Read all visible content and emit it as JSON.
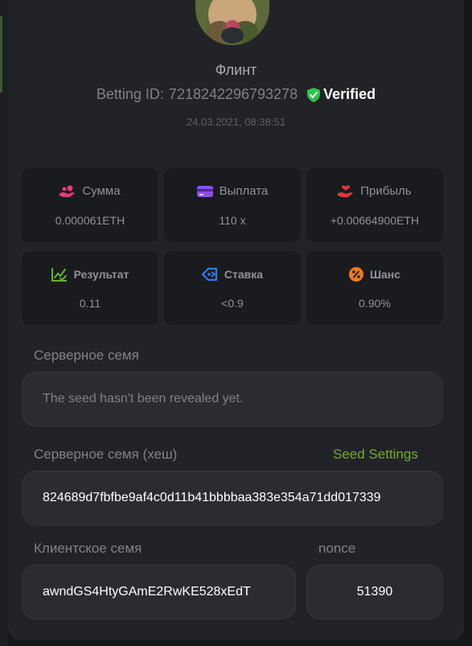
{
  "player": {
    "name": "Флинт",
    "betting_label": "Betting ID:",
    "betting_id": "7218242296793278",
    "verified_label": "Verified",
    "datetime": "24.03.2021, 08:38:51"
  },
  "stats": [
    {
      "icon": "coins-hand-icon",
      "label": "Сумма",
      "value": "0.000061ETH",
      "color": "#e63a7a"
    },
    {
      "icon": "credit-card-icon",
      "label": "Выплата",
      "value": "110 x",
      "color": "#8a4ef0"
    },
    {
      "icon": "hand-heart-icon",
      "label": "Прибыль",
      "value": "+0.00664900ETH",
      "color": "#e8343a"
    },
    {
      "icon": "chart-check-icon",
      "label": "Результат",
      "value": "0.11",
      "color": "#5cb82e"
    },
    {
      "icon": "tag-icon",
      "label": "Ставка",
      "value": "<0.9",
      "color": "#2e7df2"
    },
    {
      "icon": "percent-icon",
      "label": "Шанс",
      "value": "0.90%",
      "color": "#f07a1a"
    }
  ],
  "server_seed": {
    "label": "Серверное семя",
    "value": "The seed hasn't been revealed yet."
  },
  "server_seed_hash": {
    "label": "Серверное семя (хеш)",
    "value": "824689d7fbfbe9af4c0d11b41bbbbaa383e354a71dd017339",
    "settings_link": "Seed Settings"
  },
  "client_seed": {
    "label": "Клиентское семя",
    "value": "awndGS4HtyGAmE2RwKE528xEdT"
  },
  "nonce": {
    "label": "nonce",
    "value": "51390"
  },
  "colors": {
    "accent_green": "#6fae2f",
    "verified_green": "#2fc24a",
    "modal_bg": "#222326",
    "card_bg": "#1a1b1e"
  }
}
